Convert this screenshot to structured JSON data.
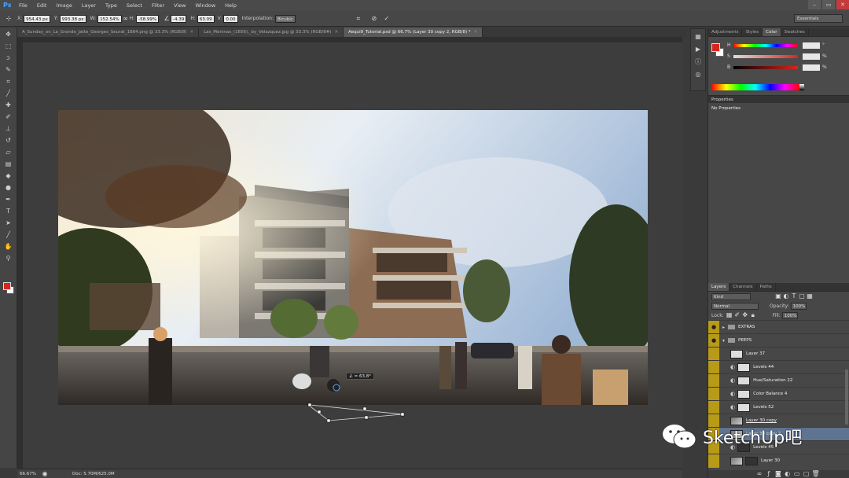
{
  "app": {
    "logo": "Ps"
  },
  "menu": [
    "File",
    "Edit",
    "Image",
    "Layer",
    "Type",
    "Select",
    "Filter",
    "View",
    "Window",
    "Help"
  ],
  "options": {
    "x_label": "X:",
    "x_value": "954.43 px",
    "y_label": "Y:",
    "y_value": "993.38 px",
    "w_label": "W:",
    "w_value": "152.54%",
    "h_label": "H:",
    "h_value": "-58.99%",
    "angle_value": "-4.39",
    "hskew_label": "H:",
    "hskew_value": "63.09",
    "vskew_label": "V:",
    "vskew_value": "0.00",
    "interp_label": "Interpolation:",
    "interp_value": "Bicubic",
    "workspace": "Essentials"
  },
  "tabs": [
    {
      "label": "A_Sunday_on_La_Grande_Jatte_Georges_Seurat_1884.png @ 33.3% (RGB/8)",
      "active": false
    },
    {
      "label": "Las_Meninas_(1656),_by_Velazquez.jpg @ 33.3% (RGB/8#)",
      "active": false
    },
    {
      "label": "Aequi9_Tutorial.psd @ 66.7% (Layer 30 copy 2, RGB/8) *",
      "active": true
    }
  ],
  "transform_readout": "∠ = 63.8°",
  "status": {
    "zoom": "66.67%",
    "doc": "Doc: 5.70M/625.0M"
  },
  "panels": {
    "top_tabs": [
      "Adjustments",
      "Styles",
      "Color",
      "Swatches"
    ],
    "color": {
      "rows": [
        {
          "label": "H",
          "value": "",
          "unit": "°"
        },
        {
          "label": "S",
          "value": "",
          "unit": "%"
        },
        {
          "label": "B",
          "value": "",
          "unit": "%"
        }
      ]
    },
    "properties_title": "Properties",
    "properties_body": "No Properties",
    "layer_tabs": [
      "Layers",
      "Channels",
      "Paths"
    ],
    "filter_kind": "Kind",
    "blend_mode": "Normal",
    "opacity_label": "Opacity:",
    "opacity_value": "100%",
    "lock_label": "Lock:",
    "fill_label": "Fill:",
    "fill_value": "100%"
  },
  "layers": [
    {
      "name": "EXTRAS",
      "type": "group"
    },
    {
      "name": "PEEPS",
      "type": "group"
    },
    {
      "name": "Layer 37",
      "type": "layer"
    },
    {
      "name": "Levels 44",
      "type": "adj"
    },
    {
      "name": "Hue/Saturation 22",
      "type": "adj"
    },
    {
      "name": "Color Balance 4",
      "type": "adj"
    },
    {
      "name": "Levels 52",
      "type": "adj"
    },
    {
      "name": "Layer 30 copy",
      "type": "photo"
    },
    {
      "name": "Layer 30 copy 2",
      "type": "photo",
      "selected": true
    },
    {
      "name": "Levels 45",
      "type": "adj"
    },
    {
      "name": "Layer 30",
      "type": "photo"
    }
  ],
  "watermark": "SketchUp吧",
  "colors": {
    "fg": "#d7261e",
    "bg": "#ffffff",
    "eye_column": "#b89a19",
    "selection": "#5f7491"
  }
}
